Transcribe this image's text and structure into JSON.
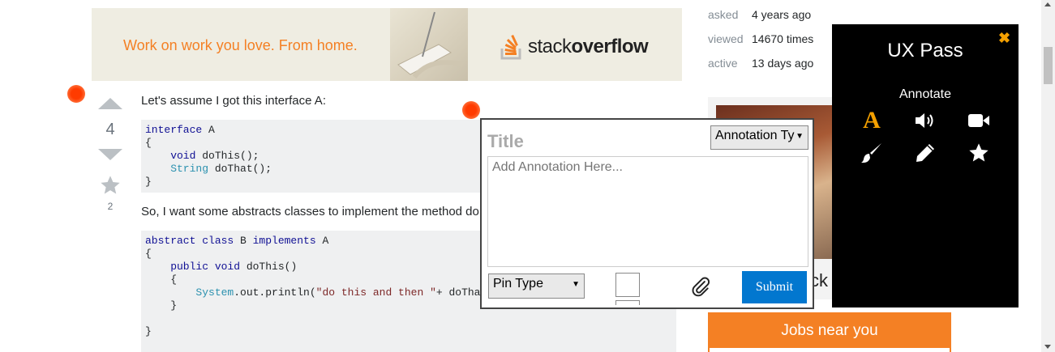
{
  "banner": {
    "tagline": "Work on work you love. From home.",
    "logo_light": "stack",
    "logo_bold": "overflow"
  },
  "stats": [
    {
      "label": "asked",
      "value": "4 years ago"
    },
    {
      "label": "viewed",
      "value": "14670 times"
    },
    {
      "label": "active",
      "value": "13 days ago"
    }
  ],
  "vote": {
    "score": "4",
    "favorites": "2"
  },
  "question": {
    "intro": "Let's assume I got this interface A:",
    "middle": "So, I want some abstracts classes to implement the method do"
  },
  "code1": {
    "line1_kw": "interface",
    "line1_rest": " A",
    "line2": "{",
    "line3_kw": "    void",
    "line3_rest": " doThis();",
    "line4_ty": "    String",
    "line4_rest": " doThat();",
    "line5": "}"
  },
  "code2": {
    "l1_kw1": "abstract class",
    "l1_mid": " B ",
    "l1_kw2": "implements",
    "l1_rest": " A",
    "l2": "{",
    "l3_kw": "    public void",
    "l3_rest": " doThis()",
    "l4": "    {",
    "l5_ty": "        System",
    "l5_mid": ".out.println(",
    "l5_str": "\"do this and then \"",
    "l5_rest": "+ doTha",
    "l6": "    }",
    "l7": "",
    "l8": "}"
  },
  "annotation_form": {
    "title_placeholder": "Title",
    "type_select": "Annotation Ty",
    "text_placeholder": "Add Annotation Here...",
    "pin_select": "Pin Type",
    "submit": "Submit"
  },
  "ux_pass": {
    "title": "UX Pass",
    "subtitle": "Annotate",
    "close": "✖",
    "text_tool": "A",
    "icons": [
      "text-icon",
      "audio-icon",
      "video-icon",
      "brush-icon",
      "pencil-icon",
      "star-icon"
    ],
    "accent": "#f4a000"
  },
  "sidebar": {
    "ad_text_partial": "ck",
    "jobs_title": "Jobs near you"
  },
  "colors": {
    "brand_orange": "#f48024",
    "submit_blue": "#0277cf",
    "pin_red": "#ff3b00"
  }
}
